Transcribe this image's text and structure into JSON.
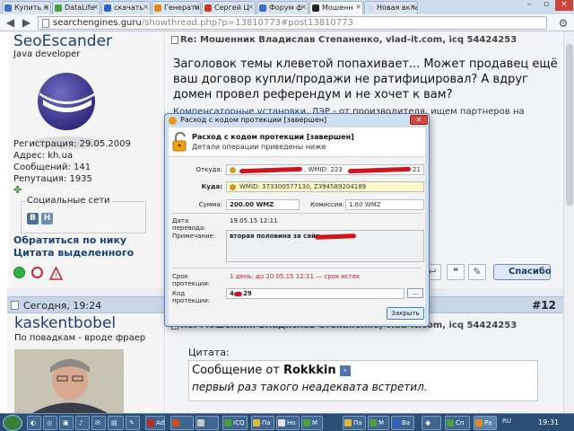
{
  "browser": {
    "tabs": [
      {
        "label": "Купить н",
        "fav_color": "#3a6fcf"
      },
      {
        "label": "DataLife",
        "fav_color": "#4f9d3a"
      },
      {
        "label": "скачать",
        "fav_color": "#2f62c2"
      },
      {
        "label": "Генерати",
        "fav_color": "#e08a1e"
      },
      {
        "label": "Сергей Ц",
        "fav_color": "#d43424"
      },
      {
        "label": "Форум ф",
        "fav_color": "#3a6fcf"
      },
      {
        "label": "Мошенн",
        "fav_color": "#222222"
      },
      {
        "label": "Новая вкла",
        "fav_color": "#cfdcec"
      }
    ],
    "url_host": "searchengines.guru",
    "url_path": "/showthread.php?p=13810773#post13810773"
  },
  "post1": {
    "username": "SeoEscander",
    "user_title": "Java developer",
    "registration": "Регистрация: 29.05.2009",
    "address": "Адрес: kh.ua",
    "posts": "Сообщений: 141",
    "reputation": "Репутация: 1935",
    "social_label": "Социальные сети",
    "social_b": "В",
    "social_h": "H",
    "link_nick": "Обратиться по нику",
    "link_quote": "Цитата выделенного",
    "title": "Re: Мошенник Владислав Степаненко, vlad-it.com, icq 54424253",
    "text": "Заголовок темы клеветой попахивает... Может продавец ещё ваш договор купли/продажи не ратифицировал? А вдруг домен провел референдум и не хочет к вам?",
    "link_text": "Компенсаторные установки, ЛЭР",
    "link_rest": " - от производителя, ищем партнеров на",
    "thanks_label": "Спасибо"
  },
  "post2": {
    "date": "Сегодня, 19:24",
    "number": "#12",
    "username": "kaskentbobel",
    "user_title": "По повадкам - вроде фраер",
    "title": "Re: Мошенник Владислав Степаненко, vlad-it.com, icq 54424253",
    "quote_label": "Цитата:",
    "quote_from_prefix": "Сообщение от ",
    "quote_author": "Rokkkin",
    "quote_text": "первый раз такого неадеквата встретил."
  },
  "dialog": {
    "window_title": "Расход с кодом протекции [завершен]",
    "close_glyph": "✕",
    "head_title": "Расход с кодом протекции [завершен]",
    "head_subtitle": "Детали операции приведены ниже",
    "from_label": "Откуда:",
    "from_value": ", WMID: 223",
    "from_tail": "21",
    "to_label": "Куда:",
    "to_value": "WMID: 373300577130, Z394589204189",
    "sum_label": "Сумма:",
    "sum_value": "200.00 WMZ",
    "fee_label": "Комиссия:",
    "fee_value": "1.60 WMZ",
    "date_label": "Дата перевода:",
    "date_value": "19.05.15 12:11",
    "note_label": "Примечание:",
    "note_value": "вторая половина за сайт",
    "protection_label": "Срок протекции:",
    "protection_value": "1 день, до 20.05.15 12:11 — срок истек",
    "code_label": "Код протекции:",
    "code_value": "4",
    "code_tail": "29",
    "dots": "...",
    "close_button": "Закрыть"
  },
  "taskbar": {
    "items": [
      "Ad",
      "",
      "",
      "ICQ",
      "Па",
      "Но",
      "М",
      "Па",
      "М",
      "Ва",
      "Сп",
      "Ра"
    ],
    "lang": "RU",
    "clock": "19:31"
  }
}
